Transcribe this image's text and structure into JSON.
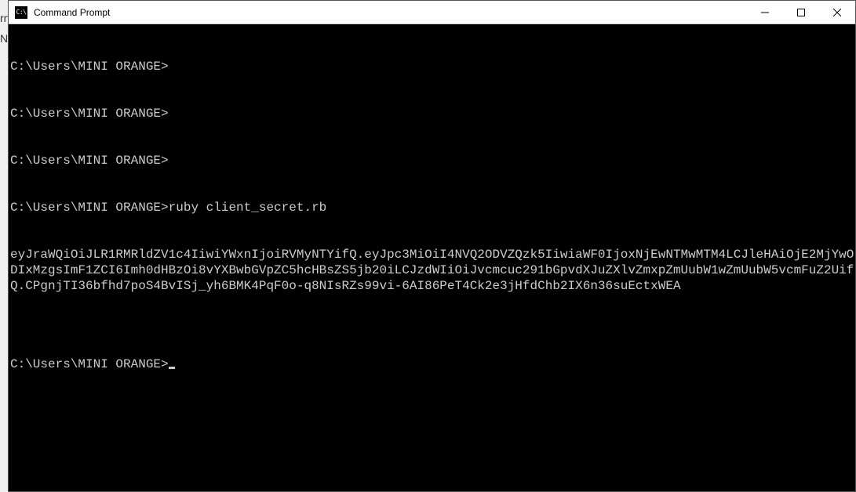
{
  "background": {
    "line1": "rn",
    "line2": "Nc"
  },
  "window": {
    "title": "Command Prompt",
    "icon_label": "cmd-icon",
    "icon_text": "C:\\"
  },
  "terminal": {
    "lines": [
      "C:\\Users\\MINI ORANGE>",
      "C:\\Users\\MINI ORANGE>",
      "C:\\Users\\MINI ORANGE>",
      "C:\\Users\\MINI ORANGE>ruby client_secret.rb",
      "eyJraWQiOiJLR1RMRldZV1c4IiwiYWxnIjoiRVMyNTYifQ.eyJpc3MiOiI4NVQ2ODVZQzk5IiwiaWF0IjoxNjEwNTMwMTM4LCJleHAiOjE2MjYwODIxMzgsImF1ZCI6Imh0dHBzOi8vYXBwbGVpZC5hcHBsZS5jb20iLCJzdWIiOiJvcmcuc291bGpvdXJuZXlvZmxpZmUubW1wZmUubW5vcmFuZ2UifQ.CPgnjTI36bfhd7poS4BvISj_yh6BMK4PqF0o-q8NIsRZs99vi-6AI86PeT4Ck2e3jHfdChb2IX6n36suEctxWEA",
      "",
      "C:\\Users\\MINI ORANGE>"
    ]
  }
}
